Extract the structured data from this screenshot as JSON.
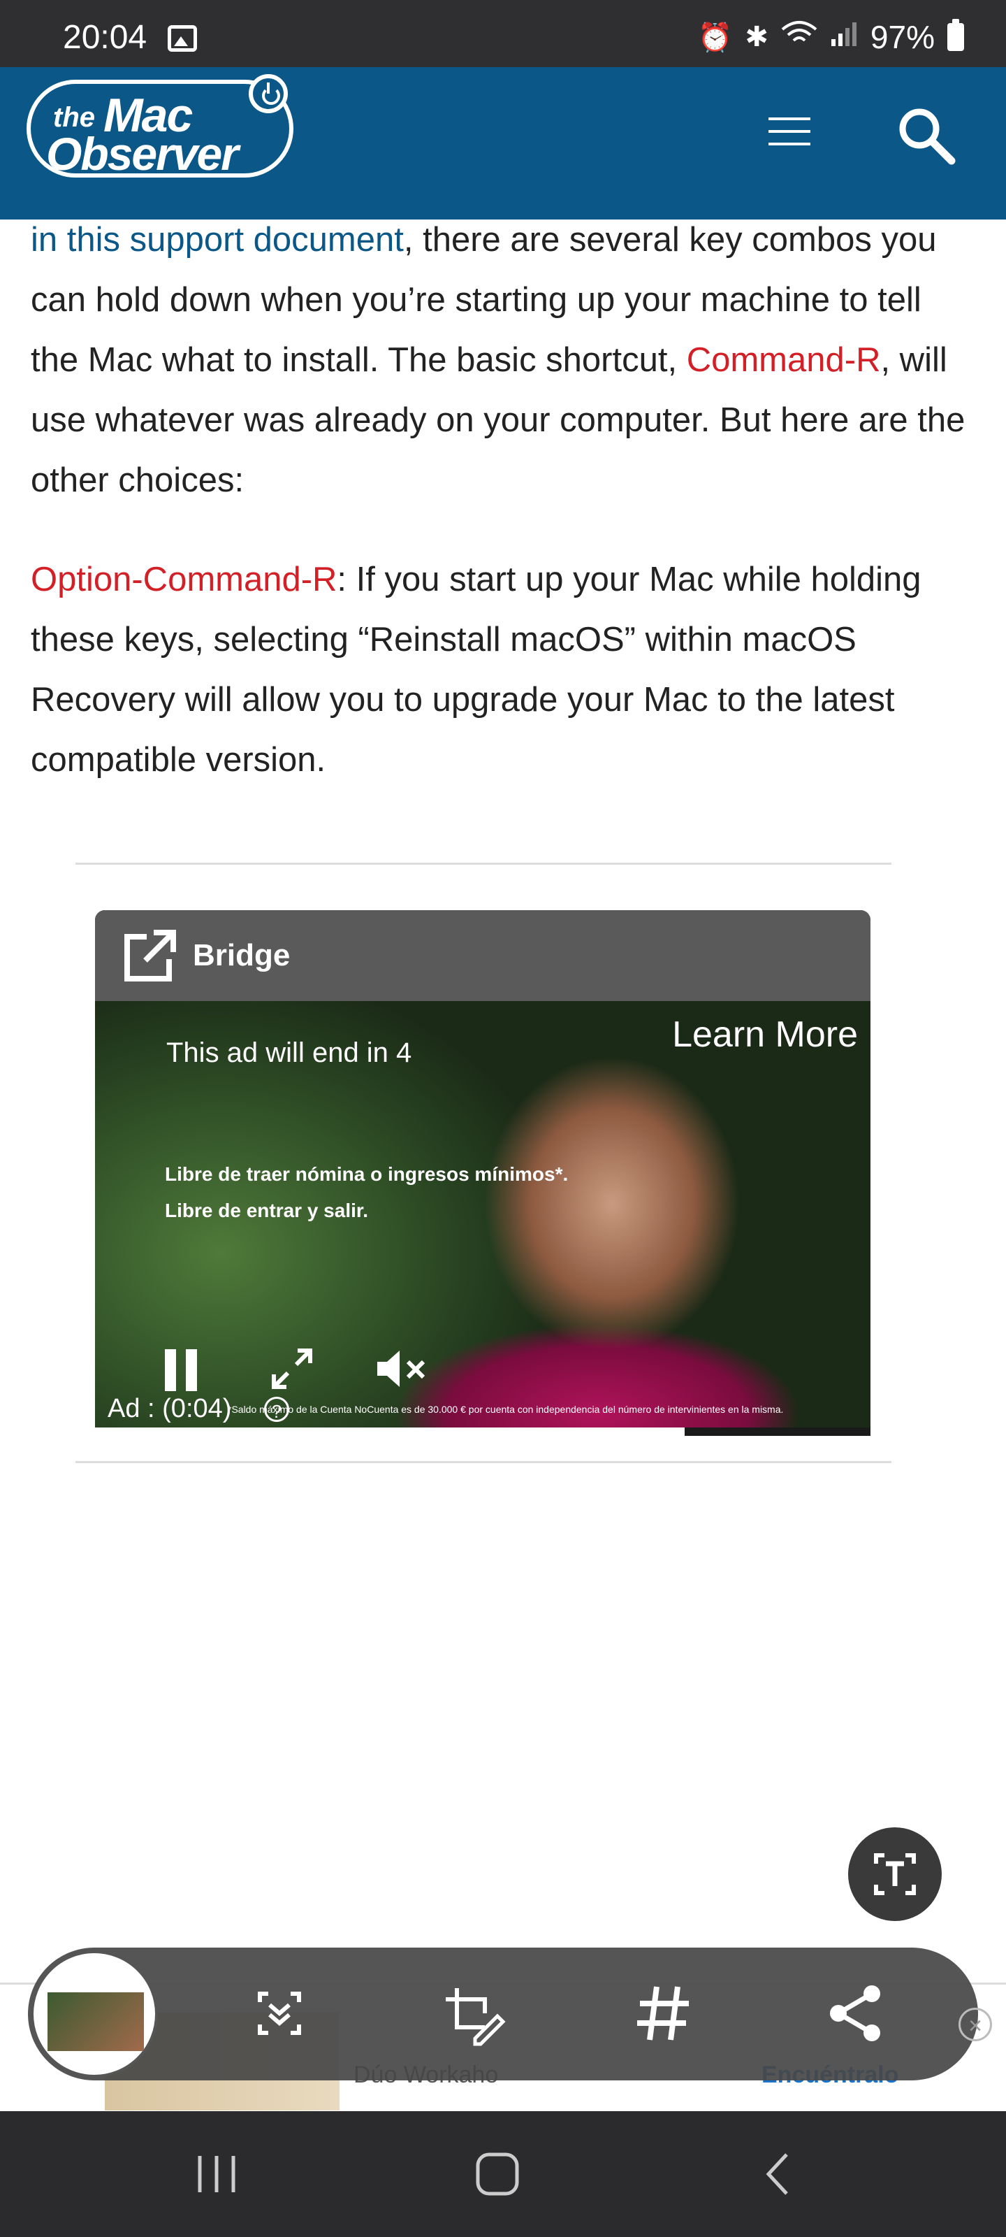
{
  "status_bar": {
    "time": "20:04",
    "battery": "97%"
  },
  "header": {
    "logo_the": "the",
    "logo_mac": "Mac",
    "logo_observer": "Observer"
  },
  "article": {
    "p1_link": "in this support document",
    "p1_text_a": ", there are several key combos you can hold down when you’re starting up your machine to tell the Mac what to install. The basic shortcut, ",
    "p1_link2": "Command-R",
    "p1_text_b": ", will use whatever was already on your computer. But here are the other choices:",
    "p2_link": "Option-Command-R",
    "p2_text": ": If you start up your Mac while holding these keys, selecting “Reinstall macOS” within macOS Recovery will allow you to upgrade your Mac to the latest compatible version."
  },
  "ad": {
    "brand": "Bridge",
    "timer": "This ad will end in 4",
    "learn_more": "Learn More",
    "line1": "Libre de traer nómina o ingresos mínimos*.",
    "line2": "Libre de entrar y salir.",
    "label": "Ad : (0:04)",
    "fine_print": "*Saldo máximo de la Cuenta NoCuenta es de 30.000 € por cuenta con independencia del número de intervinientes en la misma.",
    "progress": 0.76
  },
  "peek_ad": {
    "text": "Dúo Workaho",
    "link": "Encuéntralo"
  },
  "colors": {
    "header_bg": "#0b5888",
    "link_red": "#d31f26",
    "link_blue": "#0b5888"
  }
}
